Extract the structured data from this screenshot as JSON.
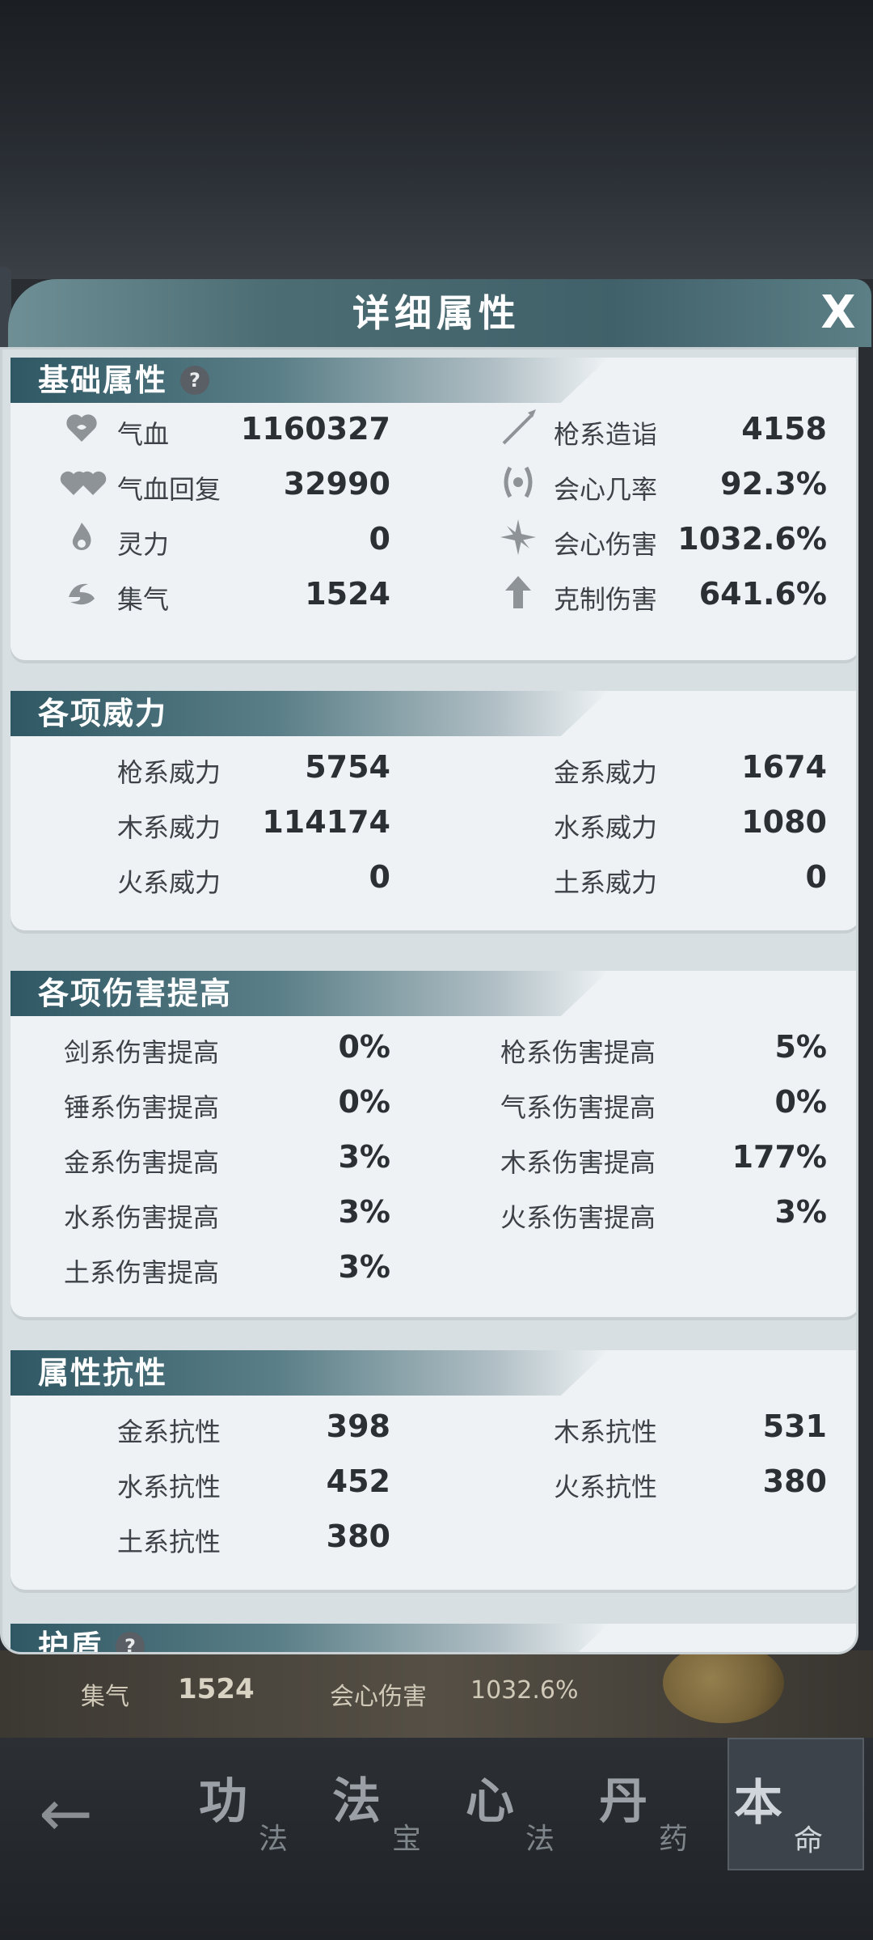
{
  "modal": {
    "title": "详细属性",
    "close_label": "X"
  },
  "sections": {
    "basic": {
      "title": "基础属性",
      "help": "?",
      "left": [
        {
          "icon": "heart-icon",
          "label": "气血",
          "value": "1160327"
        },
        {
          "icon": "double-heart-icon",
          "label": "气血回复",
          "value": "32990"
        },
        {
          "icon": "spirit-flame-icon",
          "label": "灵力",
          "value": "0"
        },
        {
          "icon": "swirl-icon",
          "label": "集气",
          "value": "1524"
        }
      ],
      "right": [
        {
          "icon": "spear-icon",
          "label": "枪系造诣",
          "value": "4158"
        },
        {
          "icon": "crit-rate-icon",
          "label": "会心几率",
          "value": "92.3%"
        },
        {
          "icon": "starburst-icon",
          "label": "会心伤害",
          "value": "1032.6%"
        },
        {
          "icon": "arrow-up-icon",
          "label": "克制伤害",
          "value": "641.6%"
        }
      ]
    },
    "power": {
      "title": "各项威力",
      "left": [
        {
          "label": "枪系威力",
          "value": "5754"
        },
        {
          "label": "木系威力",
          "value": "114174"
        },
        {
          "label": "火系威力",
          "value": "0"
        }
      ],
      "right": [
        {
          "label": "金系威力",
          "value": "1674"
        },
        {
          "label": "水系威力",
          "value": "1080"
        },
        {
          "label": "土系威力",
          "value": "0"
        }
      ]
    },
    "damage": {
      "title": "各项伤害提高",
      "left": [
        {
          "label": "剑系伤害提高",
          "value": "0%"
        },
        {
          "label": "锤系伤害提高",
          "value": "0%"
        },
        {
          "label": "金系伤害提高",
          "value": "3%"
        },
        {
          "label": "水系伤害提高",
          "value": "3%"
        },
        {
          "label": "土系伤害提高",
          "value": "3%"
        }
      ],
      "right": [
        {
          "label": "枪系伤害提高",
          "value": "5%"
        },
        {
          "label": "气系伤害提高",
          "value": "0%"
        },
        {
          "label": "木系伤害提高",
          "value": "177%"
        },
        {
          "label": "火系伤害提高",
          "value": "3%"
        }
      ]
    },
    "resist": {
      "title": "属性抗性",
      "left": [
        {
          "label": "金系抗性",
          "value": "398"
        },
        {
          "label": "水系抗性",
          "value": "452"
        },
        {
          "label": "土系抗性",
          "value": "380"
        }
      ],
      "right": [
        {
          "label": "木系抗性",
          "value": "531"
        },
        {
          "label": "火系抗性",
          "value": "380"
        }
      ]
    },
    "shield": {
      "title": "护盾",
      "help": "?"
    }
  },
  "background": {
    "strip_label_1": "集气",
    "strip_value_1": "1524",
    "strip_label_2": "会心伤害",
    "strip_value_2": "1032.6%"
  },
  "nav": {
    "back_label": "←",
    "tabs": [
      {
        "main": "功",
        "sub": "法"
      },
      {
        "main": "法",
        "sub": "宝"
      },
      {
        "main": "心",
        "sub": "法"
      },
      {
        "main": "丹",
        "sub": "药"
      },
      {
        "main": "本",
        "sub": "命"
      }
    ]
  }
}
